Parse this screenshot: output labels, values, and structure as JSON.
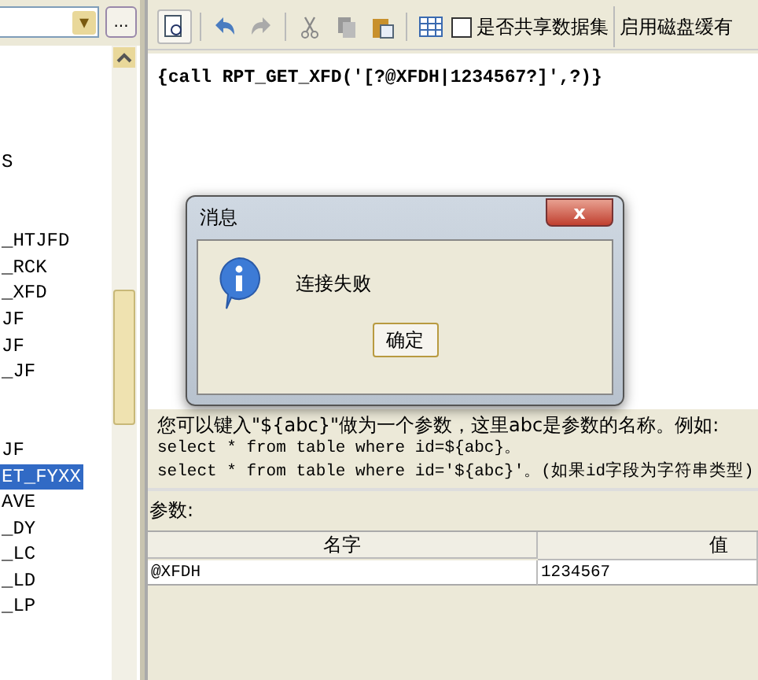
{
  "left_panel": {
    "dropdown_caret": "▾",
    "browse_button": "...",
    "items": [
      {
        "kind": "gap"
      },
      {
        "kind": "gap"
      },
      {
        "kind": "gap"
      },
      {
        "kind": "gap"
      },
      {
        "kind": "row",
        "text": "S",
        "selected": false
      },
      {
        "kind": "gap"
      },
      {
        "kind": "gap"
      },
      {
        "kind": "row",
        "text": "_HTJFD",
        "selected": false
      },
      {
        "kind": "row",
        "text": "_RCK",
        "selected": false
      },
      {
        "kind": "row",
        "text": "_XFD",
        "selected": false
      },
      {
        "kind": "row",
        "text": "JF",
        "selected": false
      },
      {
        "kind": "row",
        "text": "JF",
        "selected": false
      },
      {
        "kind": "row",
        "text": "_JF",
        "selected": false
      },
      {
        "kind": "gap"
      },
      {
        "kind": "gap"
      },
      {
        "kind": "row",
        "text": "JF",
        "selected": false
      },
      {
        "kind": "row",
        "text": "ET_FYXX",
        "selected": true
      },
      {
        "kind": "row",
        "text": "AVE",
        "selected": false
      },
      {
        "kind": "row",
        "text": "_DY",
        "selected": false
      },
      {
        "kind": "row",
        "text": "_LC",
        "selected": false
      },
      {
        "kind": "row",
        "text": "_LD",
        "selected": false
      },
      {
        "kind": "row",
        "text": "_LP",
        "selected": false
      }
    ]
  },
  "toolbar": {
    "share_checkbox": {
      "label": "是否共享数据集",
      "checked": false
    },
    "disk_cache_label": "启用磁盘缓有"
  },
  "editor": {
    "sql": "{call RPT_GET_XFD('[?@XFDH|1234567?]',?)}"
  },
  "help": {
    "intro": "您可以键入\"${abc}\"做为一个参数，这里abc是参数的名称。例如:",
    "example_1": "select * from table where id=${abc}。",
    "example_2": "select * from table where id='${abc}'。(如果id字段为字符串类型)"
  },
  "parameters": {
    "label": "参数:",
    "columns": [
      "名字",
      "值"
    ],
    "rows": [
      [
        "@XFDH",
        "1234567"
      ]
    ]
  },
  "dialog": {
    "title": "消息",
    "close": "x",
    "message": "连接失败",
    "ok_button": "确定"
  }
}
